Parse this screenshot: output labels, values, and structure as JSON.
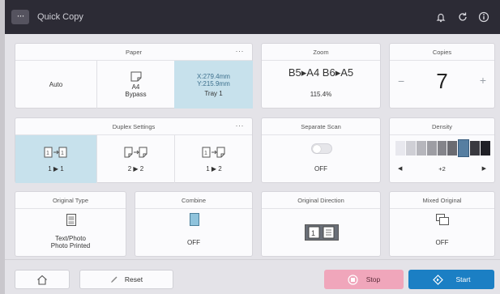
{
  "header": {
    "menu_glyph": "···",
    "title": "Quick Copy",
    "icons": [
      "bell-icon",
      "refresh-icon",
      "info-icon"
    ]
  },
  "paper": {
    "title": "Paper",
    "more": "···",
    "auto_label": "Auto",
    "bypass_size": "A4",
    "bypass_label": "Bypass",
    "tray_size_x": "X:279.4mm",
    "tray_size_y": "Y:215.9mm",
    "tray_label": "Tray 1"
  },
  "zoom": {
    "title": "Zoom",
    "ratio_label": "B5▸A4  B6▸A5",
    "percent": "115.4%"
  },
  "copies": {
    "title": "Copies",
    "minus": "−",
    "count": "7",
    "plus": "+"
  },
  "duplex": {
    "title": "Duplex Settings",
    "more": "···",
    "options": [
      {
        "label": "1 ▶ 1",
        "selected": true
      },
      {
        "label": "2 ▶ 2",
        "selected": false
      },
      {
        "label": "1 ▶ 2",
        "selected": false
      }
    ]
  },
  "separate_scan": {
    "title": "Separate Scan",
    "value": "OFF"
  },
  "density": {
    "title": "Density",
    "left_arrow": "◀",
    "right_arrow": "▶",
    "level_label": "+2",
    "steps": 9,
    "level_index": 6
  },
  "original_type": {
    "title": "Original Type",
    "value_line1": "Text/Photo",
    "value_line2": "Photo Printed"
  },
  "combine": {
    "title": "Combine",
    "value": "OFF"
  },
  "original_direction": {
    "title": "Original Direction"
  },
  "mixed_original": {
    "title": "Mixed Original",
    "value": "OFF"
  },
  "footer": {
    "reset_label": "Reset",
    "stop_label": "Stop",
    "start_label": "Start"
  },
  "colors": {
    "header_bg": "#2c2b35",
    "selected_bg": "#c7e1ec",
    "stop_bg": "#f0a6bb",
    "start_bg": "#1b7fc4",
    "density_active": "#567ea1"
  }
}
